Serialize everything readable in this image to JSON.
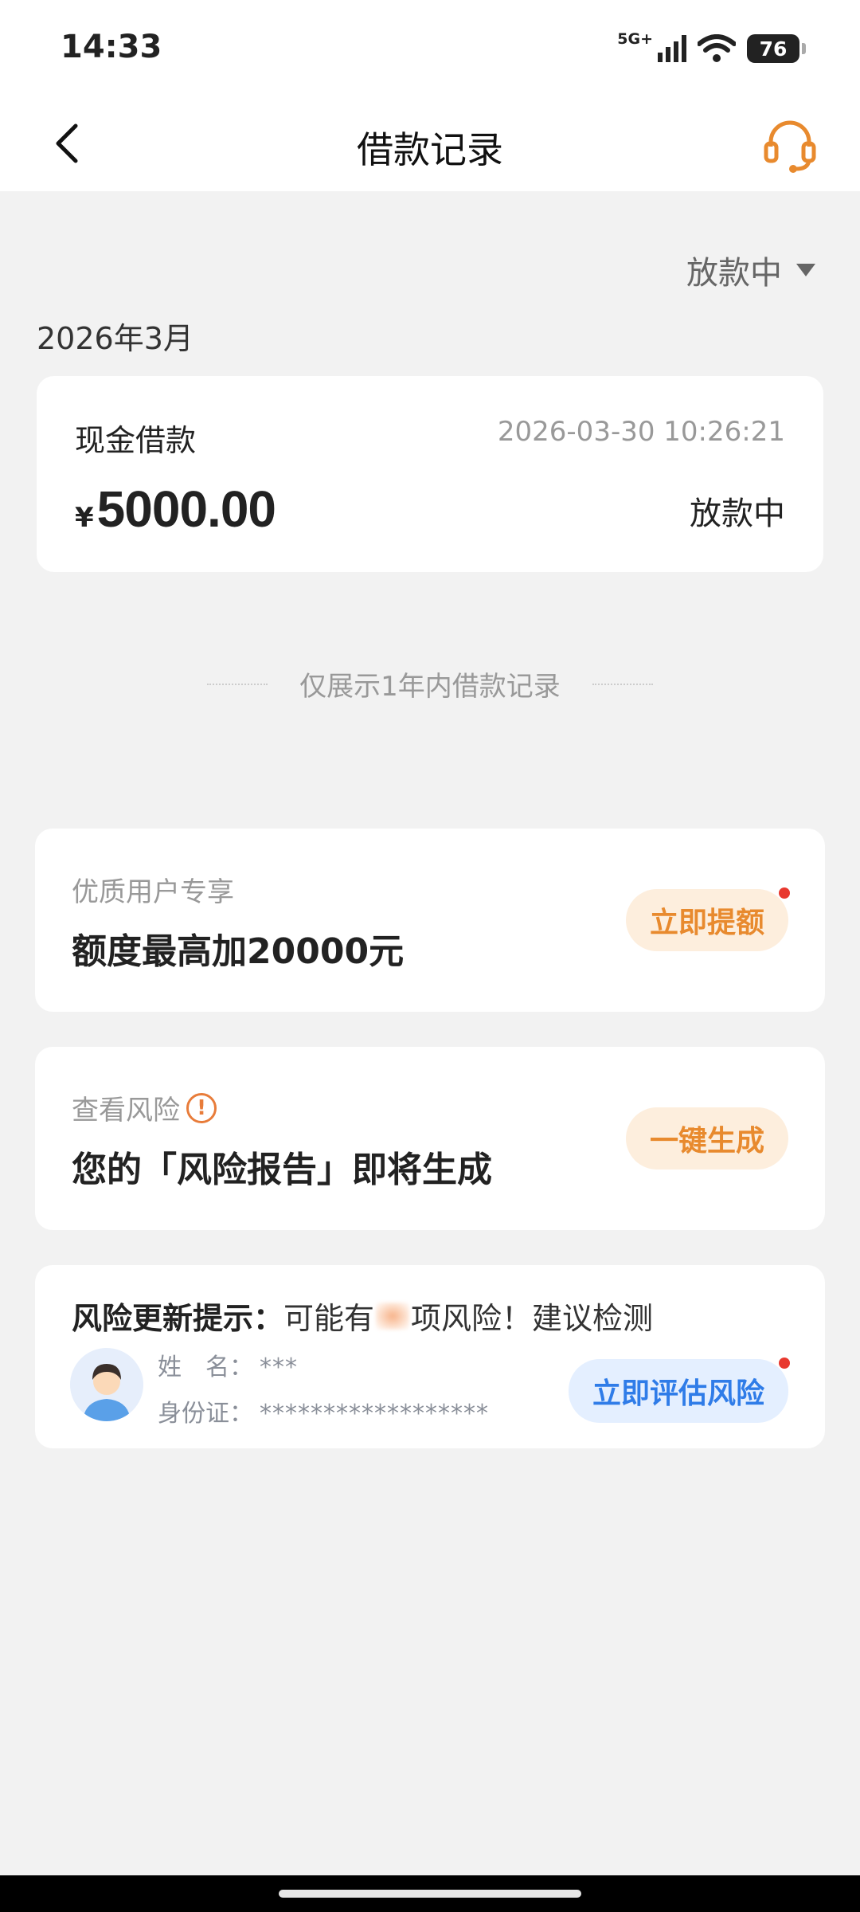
{
  "status_bar": {
    "time": "14:33",
    "network": "5G+",
    "battery": "76"
  },
  "nav": {
    "title": "借款记录",
    "back_icon": "chevron-left-icon",
    "support_icon": "headset-icon"
  },
  "filter": {
    "selected": "放款中"
  },
  "month_label": "2026年3月",
  "loan": {
    "type": "现金借款",
    "datetime": "2026-03-30 10:26:21",
    "currency": "¥",
    "amount": "5000.00",
    "status": "放款中"
  },
  "notice": "仅展示1年内借款记录",
  "promo": {
    "label": "优质用户专享",
    "headline": "额度最高加20000元",
    "button": "立即提额"
  },
  "risk": {
    "label": "查看风险",
    "headline": "您的「风险报告」即将生成",
    "button": "一键生成"
  },
  "risk_update": {
    "title_bold": "风险更新提示：",
    "title_prefix": "可能有",
    "title_suffix": "项风险！建议检测",
    "name_label": "姓　名：",
    "name_value": "***",
    "id_label": "身份证：",
    "id_value": "******************",
    "button": "立即评估风险"
  },
  "colors": {
    "accent_orange": "#e88a2e",
    "accent_blue": "#2f7ce8",
    "badge_red": "#e8382e",
    "background": "#f2f2f2"
  }
}
